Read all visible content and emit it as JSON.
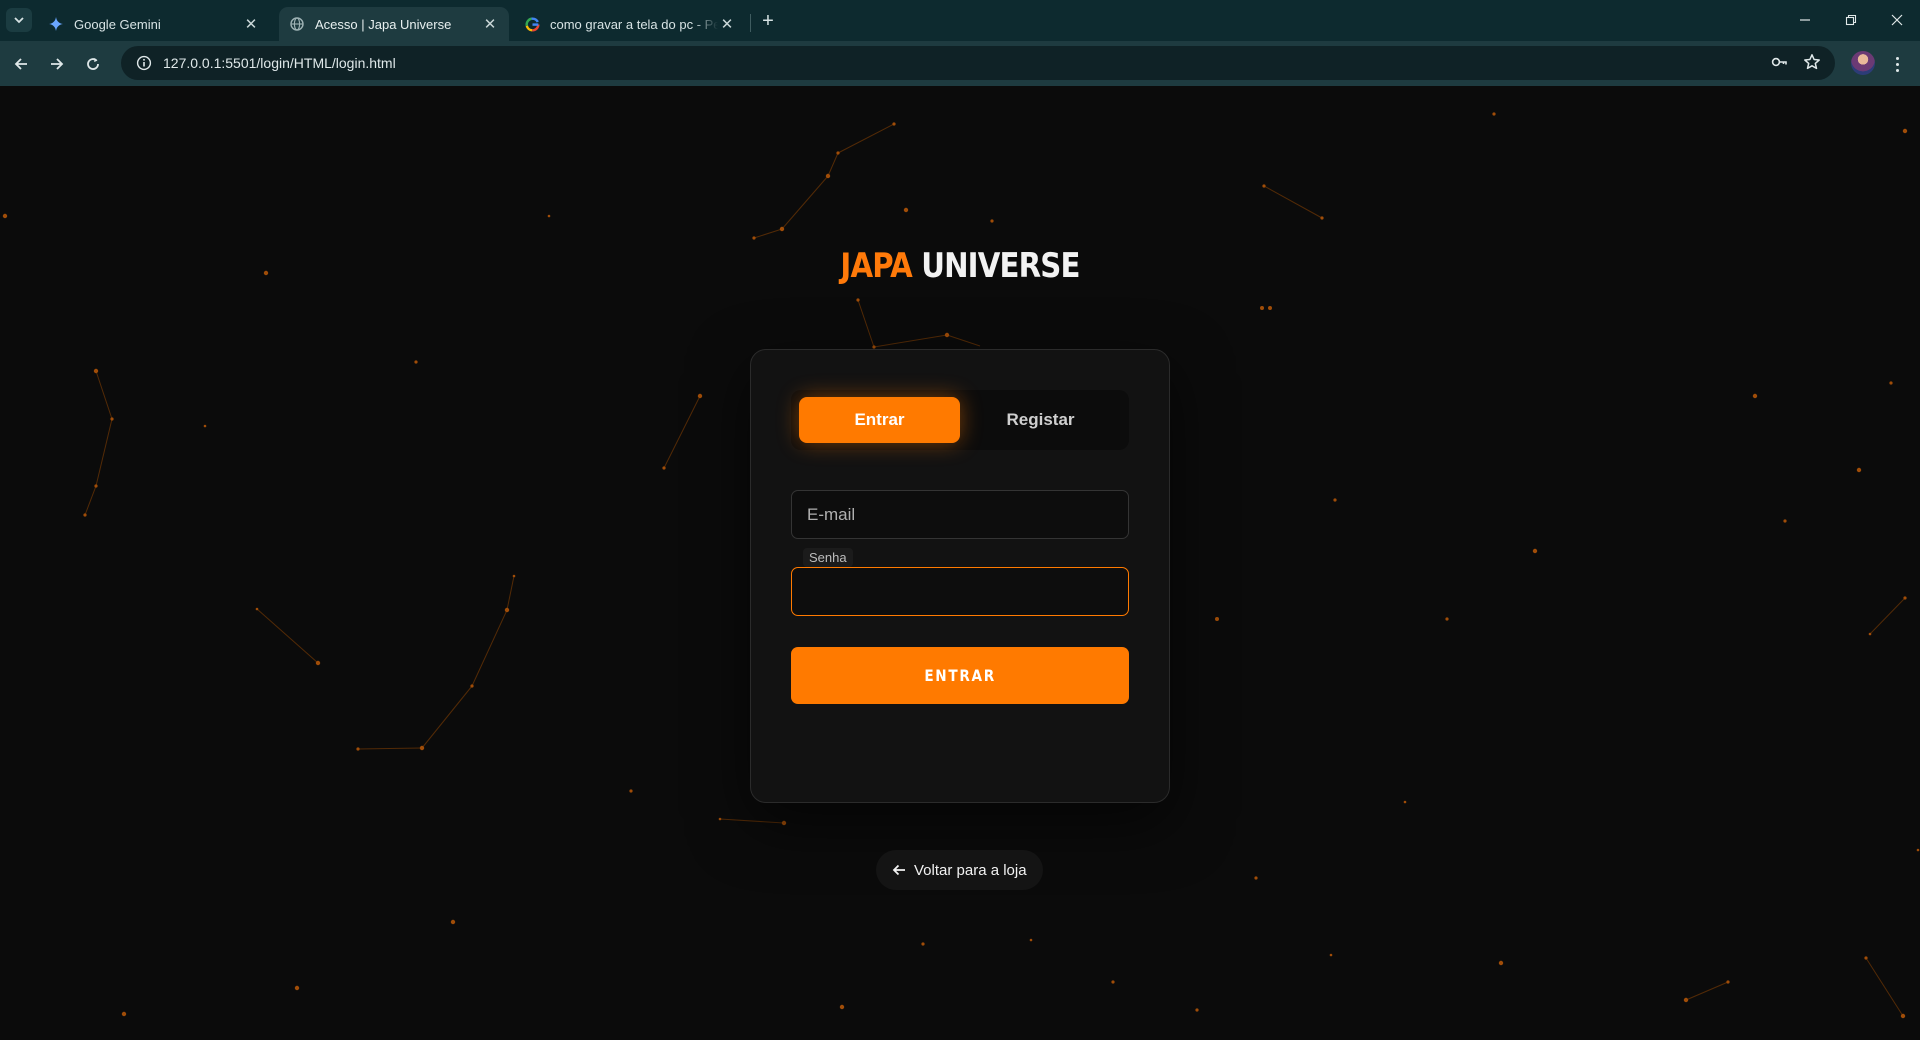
{
  "browser": {
    "tabs": [
      {
        "title": "Google Gemini",
        "favicon": "gemini-icon",
        "active": false
      },
      {
        "title": "Acesso | Japa Universe",
        "favicon": "globe-icon",
        "active": true
      },
      {
        "title": "como gravar a tela do pc - Pesq",
        "favicon": "google-icon",
        "active": false
      }
    ],
    "url": "127.0.0.1:5501/login/HTML/login.html"
  },
  "page": {
    "brand_part1": "JAPA",
    "brand_part2": "UNIVERSE",
    "tabs": {
      "login_label": "Entrar",
      "register_label": "Registar"
    },
    "form": {
      "email_placeholder": "E-mail",
      "password_tooltip": "Senha",
      "submit_label": "ENTRAR"
    },
    "back_label": "Voltar para a loja"
  },
  "colors": {
    "accent": "#ff7a00",
    "background": "#0b0b0b",
    "card": "#121212",
    "chrome": "#1e3b40"
  }
}
